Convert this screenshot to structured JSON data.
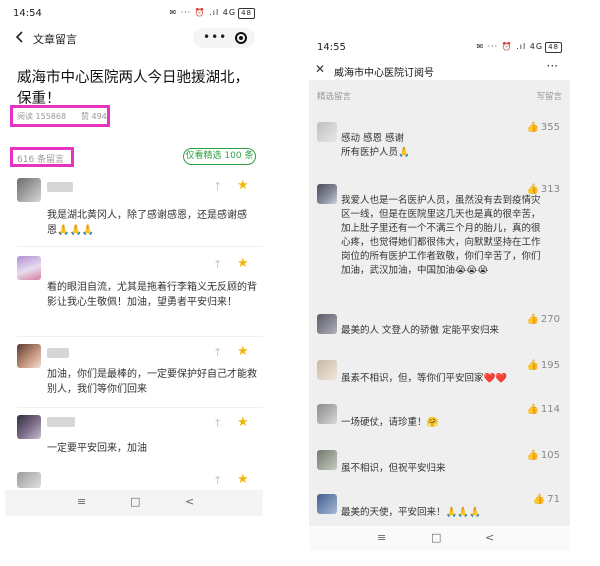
{
  "left": {
    "status": {
      "time": "14:54",
      "icons": "✉ ··· ⏰ .ıl 4G",
      "battery": "48"
    },
    "header": {
      "title": "文章留言"
    },
    "article_title": "威海市中心医院两人今日驰援湖北，保重！",
    "stats": {
      "reads": "阅读 155868",
      "likes": "赞 494"
    },
    "comment_count": "616 条留言",
    "view_featured": "仅看精选 100 条",
    "comments": [
      {
        "text": "我是湖北黄冈人，除了感谢感恩，还是感谢感恩🙏🙏🙏"
      },
      {
        "text": "看的眼泪自流，尤其是拖着行李箱义无反顾的背影让我心生敬佩！加油，望勇者平安归来！"
      },
      {
        "text": "加油，你们是最棒的，一定要保护好自己才能救别人，我们等你们回来"
      },
      {
        "text": "一定要平安回来，加油"
      }
    ],
    "nav": {
      "menu": "≡",
      "home": "□",
      "back": "<"
    }
  },
  "right": {
    "status": {
      "time": "14:55",
      "icons": "✉ ··· ⏰ .ıl 4G",
      "battery": "48"
    },
    "header": {
      "title": "威海市中心医院订阅号",
      "more": "···"
    },
    "featured_label": "精选留言",
    "write_label": "写留言",
    "comments": [
      {
        "likes": "355",
        "text": "感动 感恩 感谢\n所有医护人员🙏"
      },
      {
        "likes": "313",
        "text": "我爱人也是一名医护人员，虽然没有去到疫情灾区一线，但是在医院里这几天也是真的很辛苦，加上肚子里还有一个不满三个月的胎儿，真的很心疼，也觉得她们都很伟大，向默默坚持在工作岗位的所有医护工作者致敬，你们辛苦了，你们加油，武汉加油，中国加油😭😭😭"
      },
      {
        "likes": "270",
        "text": "最美的人 文登人的骄傲 定能平安归来"
      },
      {
        "likes": "195",
        "text": "虽素不相识，但，等你们平安回家❤️❤️"
      },
      {
        "likes": "114",
        "text": "一场硬仗，请珍重！🤗"
      },
      {
        "likes": "105",
        "text": "虽不相识，但祝平安归来"
      },
      {
        "likes": "71",
        "text": "最美的天使，平安回来！🙏🙏🙏"
      }
    ],
    "nav": {
      "menu": "≡",
      "home": "□",
      "back": "<"
    }
  },
  "colors": {
    "highlight": "#e633c4",
    "green": "#2ea043",
    "star": "#f1b70e"
  }
}
